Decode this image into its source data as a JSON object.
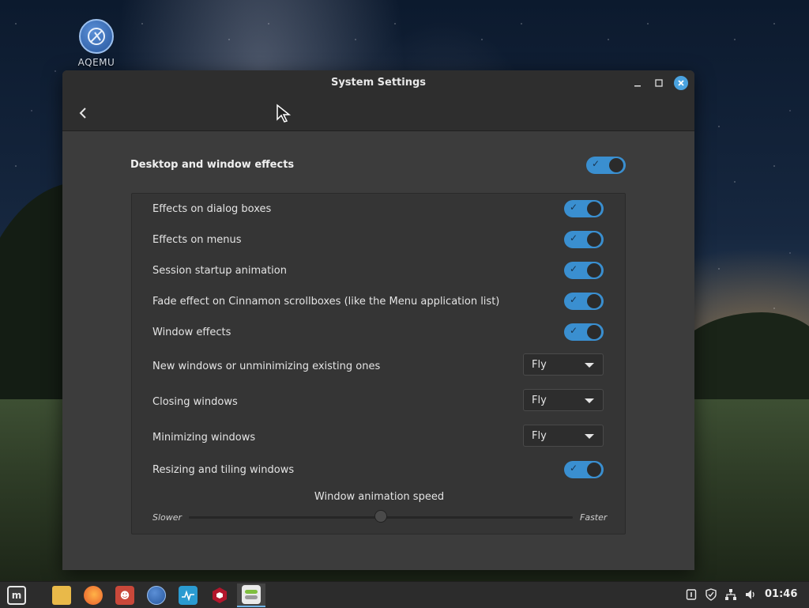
{
  "desktop": {
    "icon_label": "AQEMU"
  },
  "window": {
    "title": "System Settings",
    "buttons": {
      "minimize": "–",
      "maximize": "☐",
      "close": "✕"
    }
  },
  "settings": {
    "main_toggle_label": "Desktop and window effects",
    "main_toggle_on": true,
    "rows": [
      {
        "label": "Effects on dialog boxes",
        "control": "toggle",
        "on": true
      },
      {
        "label": "Effects on menus",
        "control": "toggle",
        "on": true
      },
      {
        "label": "Session startup animation",
        "control": "toggle",
        "on": true
      },
      {
        "label": "Fade effect on Cinnamon scrollboxes (like the Menu application list)",
        "control": "toggle",
        "on": true
      },
      {
        "label": "Window effects",
        "control": "toggle",
        "on": true
      },
      {
        "label": "New windows or unminimizing existing ones",
        "control": "dropdown",
        "value": "Fly"
      },
      {
        "label": "Closing windows",
        "control": "dropdown",
        "value": "Fly"
      },
      {
        "label": "Minimizing windows",
        "control": "dropdown",
        "value": "Fly"
      },
      {
        "label": "Resizing and tiling windows",
        "control": "toggle",
        "on": true
      }
    ],
    "speed": {
      "title": "Window animation speed",
      "min_label": "Slower",
      "max_label": "Faster",
      "value_fraction": 0.5
    }
  },
  "taskbar": {
    "apps": [
      {
        "name": "mint-menu-icon",
        "color": "#e8e8e8"
      },
      {
        "name": "files-icon",
        "color": "#e9b949"
      },
      {
        "name": "firefox-icon",
        "color": "#f07a2a"
      },
      {
        "name": "gimp-icon",
        "color": "#c9483a"
      },
      {
        "name": "aqemu-icon",
        "color": "#3a6fb8"
      },
      {
        "name": "system-monitor-icon",
        "color": "#2b9bd1"
      },
      {
        "name": "app-red-hexagon-icon",
        "color": "#b3162c"
      },
      {
        "name": "system-settings-icon",
        "color": "#7fbf3f"
      }
    ],
    "clock": "01:46"
  }
}
